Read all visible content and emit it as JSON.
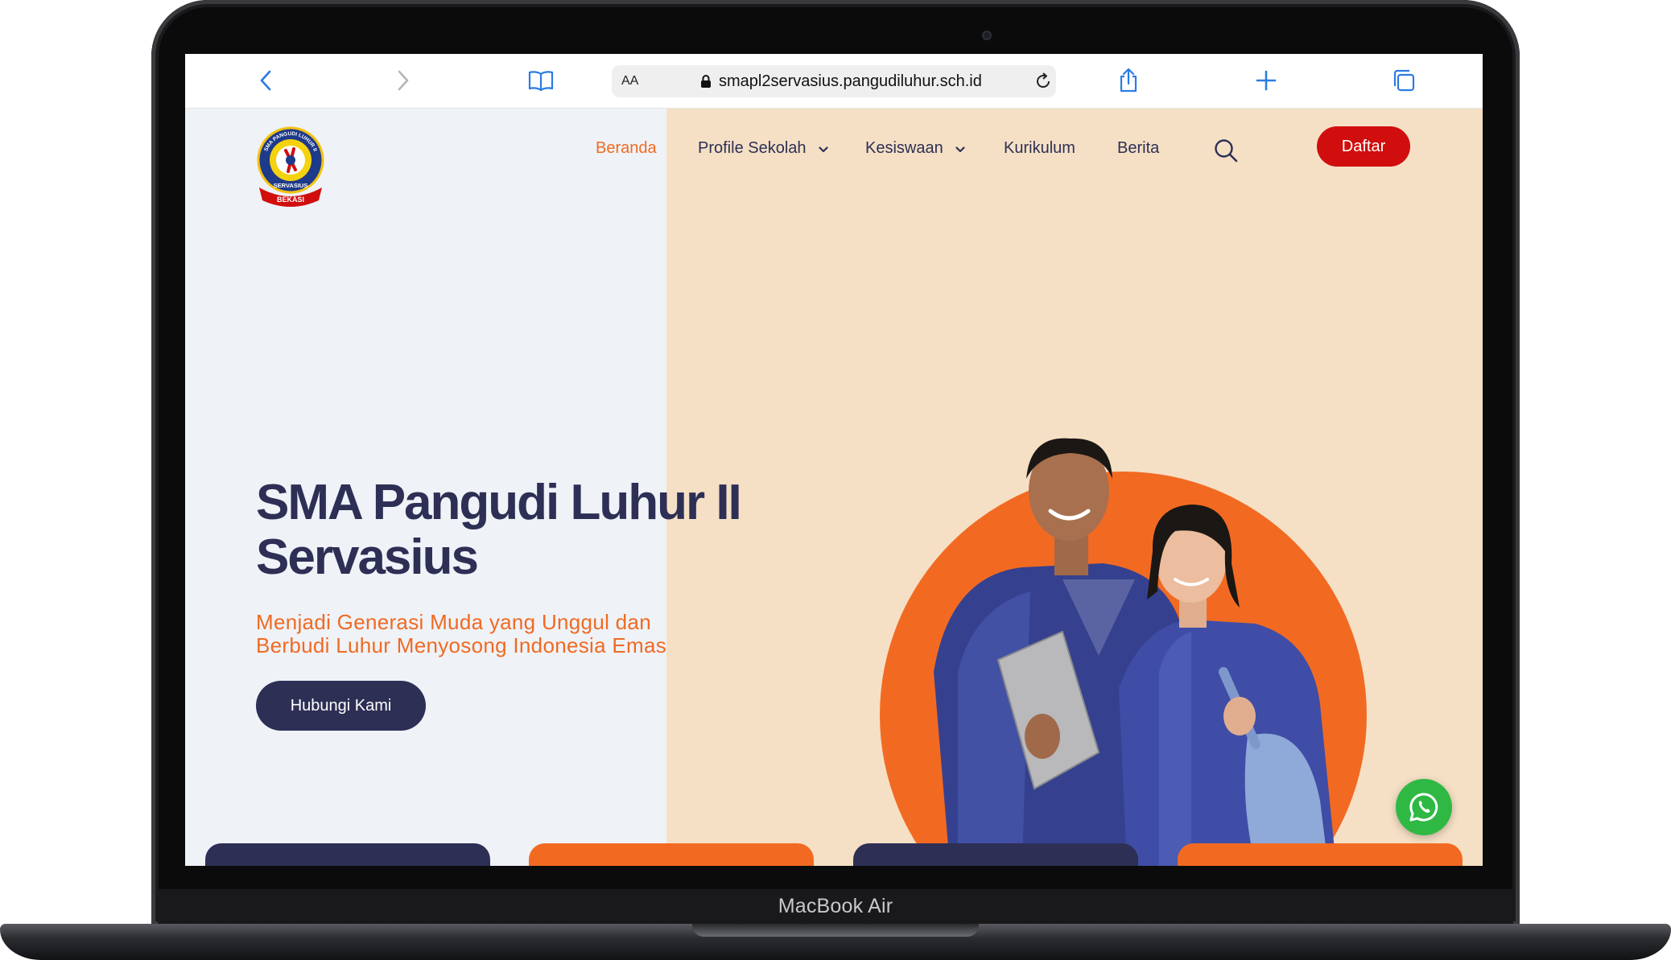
{
  "device": {
    "label": "MacBook Air"
  },
  "browser": {
    "text_size_label": "AA",
    "url": "smapl2servasius.pangudiluhur.sch.id",
    "icons": [
      "back-icon",
      "forward-icon",
      "bookmarks-icon",
      "lock-icon",
      "reload-icon",
      "share-icon",
      "new-tab-icon",
      "tabs-icon"
    ]
  },
  "site": {
    "logo": {
      "top_text": "SMA PANGUDI LUHUR II",
      "middle_text": "SERVASIUS",
      "ribbon_text": "BEKASI"
    },
    "nav": {
      "items": [
        {
          "label": "Beranda",
          "active": true
        },
        {
          "label": "Profile Sekolah",
          "has_dropdown": true
        },
        {
          "label": "Kesiswaan",
          "has_dropdown": true
        },
        {
          "label": "Kurikulum"
        },
        {
          "label": "Berita"
        }
      ],
      "search_icon": "search-icon",
      "cta_label": "Daftar"
    },
    "hero": {
      "title_line1": "SMA Pangudi Luhur II",
      "title_line2": "Servasius",
      "subtitle_line1": "Menjadi Generasi Muda yang Unggul dan",
      "subtitle_line2": "Berbudi Luhur Menyosong Indonesia Emas",
      "button_label": "Hubungi Kami"
    },
    "floating": {
      "icon": "whatsapp-icon"
    }
  },
  "colors": {
    "navy": "#2d2f55",
    "orange": "#f26a22",
    "red": "#d10e0e",
    "peach": "#f5e0c5",
    "light": "#eff2f7",
    "whatsapp": "#2fb944"
  }
}
